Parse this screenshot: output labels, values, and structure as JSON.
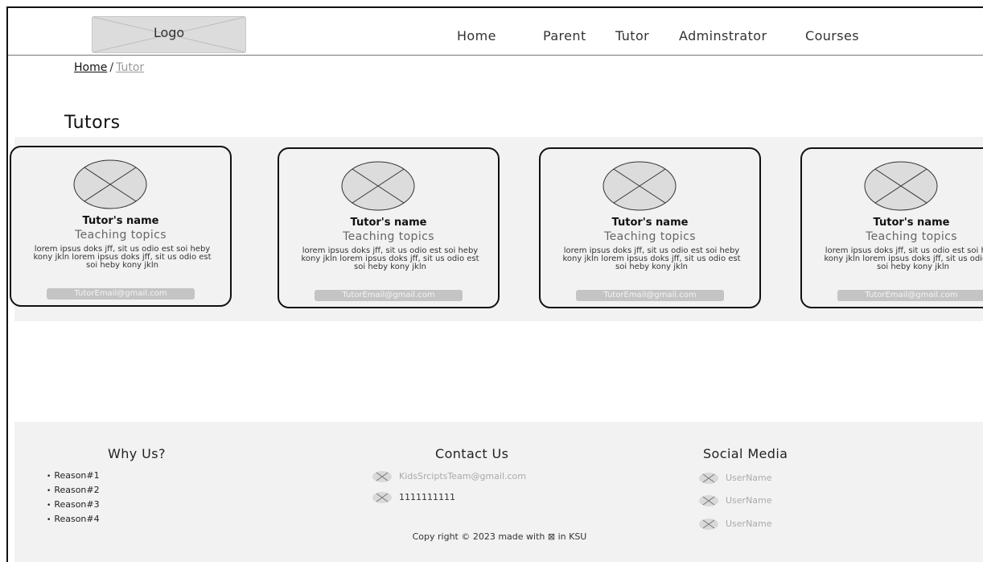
{
  "header": {
    "logo_label": "Logo",
    "nav": [
      "Home",
      "Parent",
      "Tutor",
      "Adminstrator",
      "Courses"
    ]
  },
  "breadcrumb": {
    "home": "Home",
    "separator": "/",
    "current": "Tutor"
  },
  "section_title": "Tutors",
  "tutors": [
    {
      "name": "Tutor's name",
      "topics": "Teaching topics",
      "description": "lorem ipsus doks jff, sit us odio est soi heby kony jkln lorem ipsus doks jff, sit us odio est soi heby kony jkln",
      "email": "TutorEmail@gmail.com"
    },
    {
      "name": "Tutor's name",
      "topics": "Teaching topics",
      "description": "lorem ipsus doks jff, sit us odio est soi heby kony jkln lorem ipsus doks jff, sit us odio est soi heby kony jkln",
      "email": "TutorEmail@gmail.com"
    },
    {
      "name": "Tutor's name",
      "topics": "Teaching topics",
      "description": "lorem ipsus doks jff, sit us odio est soi heby kony jkln lorem ipsus doks jff, sit us odio est soi heby kony jkln",
      "email": "TutorEmail@gmail.com"
    },
    {
      "name": "Tutor's name",
      "topics": "Teaching topics",
      "description": "lorem ipsus doks jff, sit us odio est soi heby kony jkln lorem ipsus doks jff, sit us odio est soi heby kony jkln",
      "email": "TutorEmail@gmail.com"
    }
  ],
  "footer": {
    "why_us": {
      "heading": "Why Us?",
      "reasons": [
        "Reason#1",
        "Reason#2",
        "Reason#3",
        "Reason#4"
      ]
    },
    "contact": {
      "heading": "Contact Us",
      "email": "KidsSrciptsTeam@gmail.com",
      "phone": "1111111111"
    },
    "social": {
      "heading": "Social Media",
      "accounts": [
        "UserName",
        "UserName",
        "UserName"
      ]
    },
    "copyright": "Copy right © 2023 made with ⊠ in KSU"
  },
  "colors": {
    "band_background": "#f2f2f2",
    "placeholder_gray": "#dcdcdc",
    "email_pill": "#c4c4c4",
    "border_dark": "#111111"
  }
}
